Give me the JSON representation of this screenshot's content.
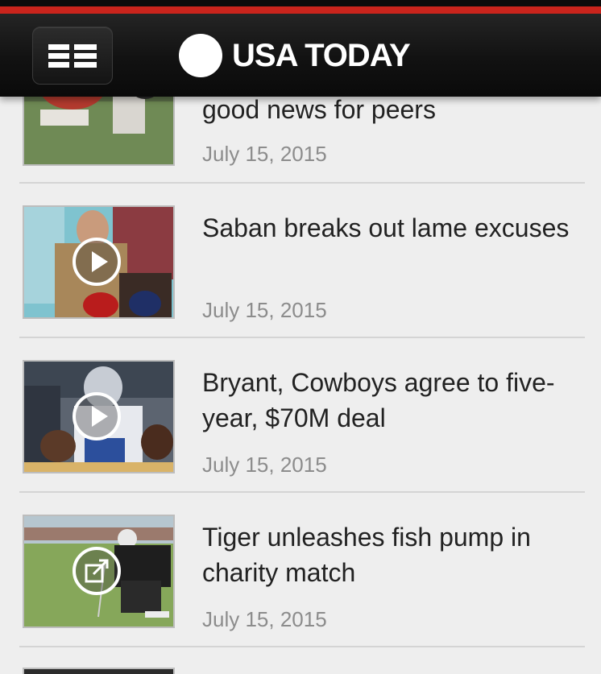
{
  "header": {
    "logo_text": "USA TODAY",
    "menu_icon": "menu-icon",
    "accent_color": "#c9241c"
  },
  "articles": [
    {
      "headline": "good news for peers",
      "date": "July 15, 2015",
      "media_icon": "play-icon"
    },
    {
      "headline": "Saban breaks out lame excuses",
      "date": "July 15, 2015",
      "media_icon": "play-icon"
    },
    {
      "headline": "Bryant, Cowboys agree to five-year, $70M deal",
      "date": "July 15, 2015",
      "media_icon": "play-icon"
    },
    {
      "headline": "Tiger unleashes fish pump in charity match",
      "date": "July 15, 2015",
      "media_icon": "external-link-icon"
    }
  ]
}
